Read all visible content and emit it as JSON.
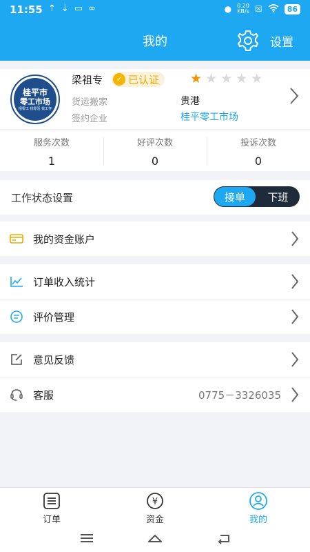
{
  "status": {
    "time": "11:55",
    "netspeed_value": "0.20",
    "netspeed_unit": "KB/s",
    "battery": "86"
  },
  "header": {
    "title": "我的",
    "settings_label": "设置"
  },
  "profile": {
    "logo_line1": "桂平市",
    "logo_line2": "零工市场",
    "logo_line3": "招零工 找零活 找工作",
    "name": "梁祖专",
    "verified_label": "已认证",
    "rating": 1,
    "rating_max": 5,
    "fields": [
      {
        "label": "货运搬家",
        "value": "贵港"
      },
      {
        "label": "签约企业",
        "value": "桂平零工市场"
      }
    ]
  },
  "stats": [
    {
      "label": "服务次数",
      "value": "1"
    },
    {
      "label": "好评次数",
      "value": "0"
    },
    {
      "label": "投诉次数",
      "value": "0"
    }
  ],
  "work_status": {
    "label": "工作状态设置",
    "on_label": "接单",
    "off_label": "下班"
  },
  "menu": {
    "account": "我的资金账户",
    "income": "订单收入统计",
    "reviews": "评价管理",
    "feedback": "意见反馈",
    "service": "客服",
    "service_phone": "0775－3326035"
  },
  "tabs": [
    {
      "label": "订单"
    },
    {
      "label": "资金"
    },
    {
      "label": "我的"
    }
  ],
  "colors": {
    "primary": "#1ea8f2",
    "star": "#f39400",
    "verified": "#f0a800",
    "toggle_bg": "#1f2b3a"
  }
}
